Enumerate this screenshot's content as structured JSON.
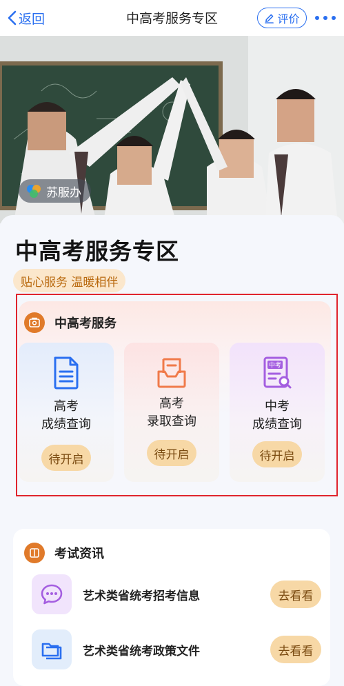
{
  "nav": {
    "back_label": "返回",
    "title": "中高考服务专区",
    "rate_label": "评价"
  },
  "hero": {
    "logo_text": "苏服办"
  },
  "page": {
    "title": "中高考服务专区",
    "slogan": "贴心服务 温暖相伴"
  },
  "services": {
    "section_title": "中高考服务",
    "tiles": [
      {
        "line1": "高考",
        "line2": "成绩查询",
        "status": "待开启",
        "icon": "document-icon"
      },
      {
        "line1": "高考",
        "line2": "录取查询",
        "status": "待开启",
        "icon": "envelope-icon"
      },
      {
        "line1": "中考",
        "line2": "成绩查询",
        "status": "待开启",
        "icon": "exam-search-icon",
        "icon_text": "中考"
      }
    ]
  },
  "news": {
    "section_title": "考试资讯",
    "items": [
      {
        "text": "艺术类省统考招考信息",
        "action": "去看看",
        "icon": "chat-bubble-icon"
      },
      {
        "text": "艺术类省统考政策文件",
        "action": "去看看",
        "icon": "folder-icon"
      }
    ]
  },
  "colors": {
    "accent_blue": "#2a6ff0",
    "highlight_red": "#e0242d",
    "status_button": "#f7d8a6",
    "slogan_bg": "#fbe7cc",
    "section_icon_orange": "#e07a2a"
  }
}
